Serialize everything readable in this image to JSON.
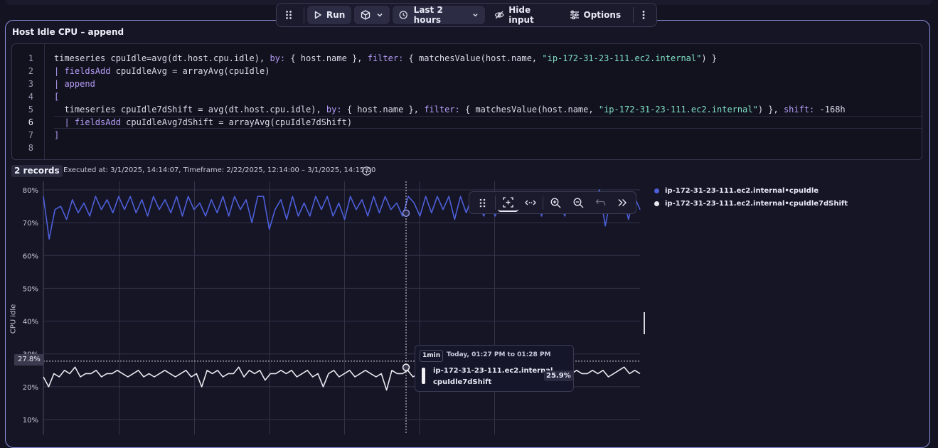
{
  "toolbar": {
    "run_label": "Run",
    "timeframe_label": "Last 2 hours",
    "hide_input_label": "Hide input",
    "options_label": "Options"
  },
  "panel": {
    "title": "Host Idle CPU – append"
  },
  "editor": {
    "lines": [
      {
        "n": "1"
      },
      {
        "n": "2"
      },
      {
        "n": "3"
      },
      {
        "n": "4"
      },
      {
        "n": "5"
      },
      {
        "n": "6"
      },
      {
        "n": "7"
      },
      {
        "n": "8"
      }
    ],
    "active_line": 6,
    "text": {
      "l1_a": "timeseries cpuIdle=avg(dt.host.cpu.idle), ",
      "l1_by": "by:",
      "l1_b": " { host.name }, ",
      "l1_filter": "filter:",
      "l1_c": " { matchesValue(host.name, ",
      "l1_str": "\"ip-172-31-23-111.ec2.internal\"",
      "l1_d": ") }",
      "l2_pipe": "| ",
      "l2_kw": "fieldsAdd",
      "l2_rest": " cpuIdleAvg = arrayAvg(cpuIdle)",
      "l3_pipe": "| ",
      "l3_kw": "append",
      "l4": "[",
      "l5_a": "  timeseries cpuIdle7dShift = avg(dt.host.cpu.idle), ",
      "l5_by": "by:",
      "l5_b": " { host.name }, ",
      "l5_filter": "filter:",
      "l5_c": " { matchesValue(host.name, ",
      "l5_str": "\"ip-172-31-23-111.ec2.internal\"",
      "l5_d": ") }, ",
      "l5_shift": "shift:",
      "l5_e": " -168h",
      "l6_pipe": "  | ",
      "l6_kw": "fieldsAdd",
      "l6_rest": " cpuIdleAvg7dShift = arrayAvg(cpuIdle7dShift)",
      "l7": "]",
      "l8": ""
    }
  },
  "result": {
    "records_label": "2 records",
    "executed_text": "Executed at: 3/1/2025, 14:14:07, Timeframe: 2/22/2025, 12:14:00 – 3/1/2025, 14:15:00"
  },
  "chart_data": {
    "type": "line",
    "ylabel": "CPU idle",
    "yticks": [
      "80%",
      "70%",
      "60%",
      "50%",
      "40%",
      "30%",
      "20%",
      "10%"
    ],
    "ylim": [
      10,
      80
    ],
    "cursor_value": "27.8%",
    "series": [
      {
        "name": "ip-172-31-23-111.ec2.internal•cpuIdle",
        "color": "#4d5fd9",
        "values": [
          78,
          65,
          74,
          75,
          71,
          77,
          73,
          76,
          72,
          78,
          74,
          77,
          73,
          78,
          74,
          78,
          73,
          77,
          72,
          78,
          74,
          77,
          73,
          78,
          72,
          78,
          74,
          76,
          72,
          77,
          73,
          78,
          72,
          78,
          74,
          77,
          70,
          78,
          78,
          68,
          74,
          77,
          71,
          78,
          72,
          76,
          72,
          78,
          74,
          78,
          72,
          76,
          71,
          78,
          74,
          77,
          72,
          78,
          73,
          78,
          74,
          76,
          72,
          78,
          76,
          72,
          78,
          73,
          78,
          74,
          78,
          71,
          78,
          73,
          78,
          77,
          72,
          76,
          72,
          78,
          74,
          78,
          73,
          79,
          74,
          79,
          72,
          78,
          74,
          78,
          72,
          78,
          73,
          79,
          73,
          77,
          80,
          69,
          78,
          73,
          79,
          71,
          78,
          74
        ],
        "legend_marker": "dot"
      },
      {
        "name": "ip-172-31-23-111.ec2.internal•cpuIdle7dShift",
        "color": "#e8e8ee",
        "values": [
          23,
          20,
          24,
          23,
          25,
          24,
          26,
          23,
          24,
          24,
          25,
          23,
          24,
          24,
          25,
          24,
          23,
          24,
          25,
          23,
          24,
          23,
          24,
          25,
          24,
          23,
          24,
          25,
          23,
          24,
          20,
          25,
          24,
          25,
          23,
          24,
          24,
          26,
          23,
          25,
          24,
          25,
          22,
          24,
          24,
          25,
          24,
          25,
          23,
          24,
          25,
          23,
          24,
          20,
          24,
          25,
          23,
          24,
          25,
          23,
          24,
          25,
          24,
          23,
          24,
          19,
          25,
          24,
          24,
          25,
          23,
          24,
          25,
          24,
          23,
          24,
          25,
          24,
          24,
          23,
          24,
          25,
          24,
          26,
          23,
          24,
          24,
          25,
          23,
          24,
          25,
          24,
          24,
          23,
          24,
          25,
          24,
          24,
          25,
          23,
          24,
          25,
          24,
          24,
          25,
          24,
          25,
          23,
          24,
          25,
          26,
          24,
          25,
          24
        ],
        "legend_marker": "dot"
      }
    ],
    "hover": {
      "series": "cpuIdle7dShift",
      "tag": "1min",
      "time": "Today, 01:27 PM to 01:28 PM",
      "host": "ip-172-31-23-111.ec2.internal",
      "metric": "cpuIdle7dShift",
      "value": "25.9%",
      "upper_value": 72.9,
      "lower_value": 25.9
    }
  }
}
